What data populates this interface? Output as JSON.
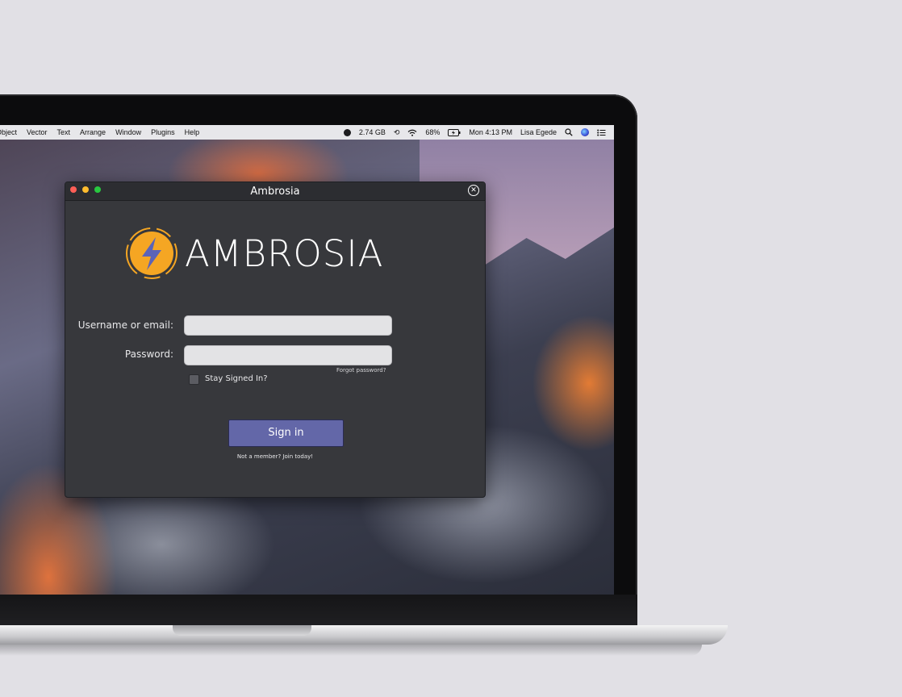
{
  "menubar": {
    "menus": [
      "Object",
      "Vector",
      "Text",
      "Arrange",
      "Window",
      "Plugins",
      "Help"
    ],
    "status": {
      "memory": "2.74 GB",
      "battery": "68%",
      "clock": "Mon 4:13 PM",
      "user": "Lisa Egede"
    }
  },
  "dialog": {
    "title": "Ambrosia",
    "brand": "AMBROSIA",
    "username_label": "Username or email:",
    "username_value": "",
    "password_label": "Password:",
    "password_value": "",
    "forgot_link": "Forgot password?",
    "stay_signed_in_label": "Stay Signed In?",
    "stay_signed_in_checked": false,
    "signin_label": "Sign in",
    "join_link": "Not a member? Join today!"
  },
  "colors": {
    "dialog_bg": "#37383c",
    "button": "#6367a8",
    "logo_orange": "#f5a623",
    "logo_bolt": "#5b63b8"
  }
}
